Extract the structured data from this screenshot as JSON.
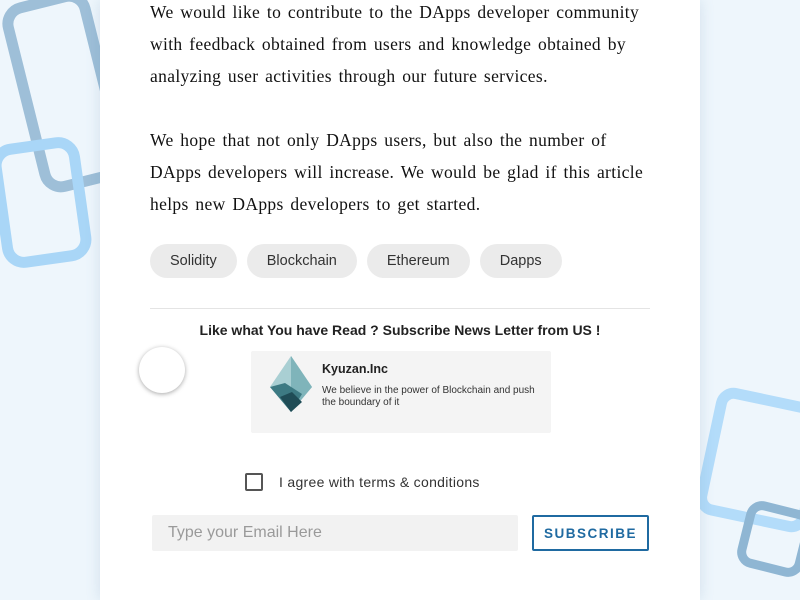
{
  "article": {
    "paragraphs": [
      "We would like to contribute to the DApps developer community with feedback obtained from users and knowledge obtained by analyzing user activities through our future services.",
      "We hope that not only DApps users, but also the number of DApps developers will increase. We would be glad if this article helps new DApps developers to get started."
    ]
  },
  "tags": [
    "Solidity",
    "Blockchain",
    "Ethereum",
    "Dapps"
  ],
  "subscribe": {
    "title": "Like what You have Read ? Subscribe News Letter from US !",
    "company": {
      "name": "Kyuzan.Inc",
      "description": "We believe in the power of Blockchain and push the boundary of it",
      "logo_icon": "kyuzan-logo-icon"
    },
    "terms_label": "I agree with terms & conditions",
    "terms_checked": false,
    "email_placeholder": "Type your Email Here",
    "email_value": "",
    "button_label": "SUBSCRIBE"
  },
  "colors": {
    "accent": "#1f6aa1",
    "tag_background": "#ebebeb",
    "page_background": "#eef6fc"
  }
}
